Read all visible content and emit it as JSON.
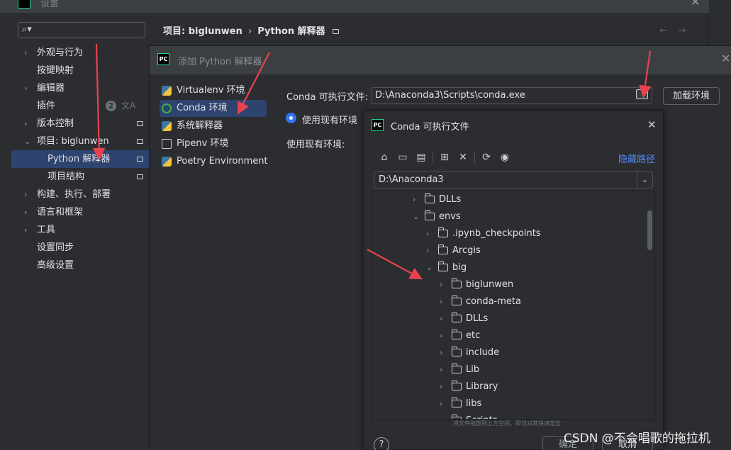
{
  "settings": {
    "title": "设置",
    "search_placeholder": "",
    "sidebar": [
      {
        "label": "外观与行为",
        "expandable": true,
        "expanded": false
      },
      {
        "label": "按键映射",
        "expandable": false
      },
      {
        "label": "编辑器",
        "expandable": true,
        "expanded": false
      },
      {
        "label": "插件",
        "expandable": false,
        "badge": "2"
      },
      {
        "label": "版本控制",
        "expandable": true,
        "expanded": false
      },
      {
        "label": "项目: biglunwen",
        "expandable": true,
        "expanded": true
      },
      {
        "label": "Python 解释器",
        "child": true,
        "selected": true
      },
      {
        "label": "项目结构",
        "child": true
      },
      {
        "label": "构建、执行、部署",
        "expandable": true,
        "expanded": false
      },
      {
        "label": "语言和框架",
        "expandable": true,
        "expanded": false
      },
      {
        "label": "工具",
        "expandable": true,
        "expanded": false
      },
      {
        "label": "设置同步",
        "expandable": false
      },
      {
        "label": "高级设置",
        "expandable": false
      }
    ],
    "breadcrumb": {
      "project": "项目: biglunwen",
      "separator": "›",
      "page": "Python 解释器"
    }
  },
  "add_interpreter": {
    "title": "添加 Python 解释器",
    "env_types": [
      {
        "label": "Virtualenv 环境",
        "icon": "python-icon"
      },
      {
        "label": "Conda 环境",
        "icon": "conda-icon",
        "selected": true
      },
      {
        "label": "系统解释器",
        "icon": "python-icon"
      },
      {
        "label": "Pipenv 环境",
        "icon": "pipenv-icon"
      },
      {
        "label": "Poetry Environment",
        "icon": "python-icon"
      }
    ],
    "conda_exe_label": "Conda 可执行文件:",
    "conda_exe_value": "D:\\Anaconda3\\Scripts\\conda.exe",
    "load_env_button": "加载环境",
    "use_existing_label": "使用现有环境",
    "existing_env_label": "使用现有环境:"
  },
  "file_chooser": {
    "title": "Conda 可执行文件",
    "hide_path": "隐藏路径",
    "path_value": "D:\\Anaconda3",
    "tree": [
      {
        "name": "DLLs",
        "depth": 0,
        "expanded": false
      },
      {
        "name": "envs",
        "depth": 0,
        "expanded": true
      },
      {
        "name": ".ipynb_checkpoints",
        "depth": 1,
        "expanded": false
      },
      {
        "name": "Arcgis",
        "depth": 1,
        "expanded": false
      },
      {
        "name": "big",
        "depth": 1,
        "expanded": true
      },
      {
        "name": "biglunwen",
        "depth": 2,
        "expanded": false
      },
      {
        "name": "conda-meta",
        "depth": 2,
        "expanded": false
      },
      {
        "name": "DLLs",
        "depth": 2,
        "expanded": false
      },
      {
        "name": "etc",
        "depth": 2,
        "expanded": false
      },
      {
        "name": "include",
        "depth": 2,
        "expanded": false
      },
      {
        "name": "Lib",
        "depth": 2,
        "expanded": false
      },
      {
        "name": "Library",
        "depth": 2,
        "expanded": false
      },
      {
        "name": "libs",
        "depth": 2,
        "expanded": false
      },
      {
        "name": "Scripts",
        "depth": 2,
        "expanded": false
      }
    ],
    "drag_hint": "将文件拖放到上方空间，即可对其快速定位",
    "help": "?",
    "ok_button": "确定",
    "cancel_button": "取消"
  },
  "watermark": "CSDN @不会唱歌的拖拉机",
  "colors": {
    "accent": "#3574f0",
    "selected_bg": "#2e436e",
    "link": "#548af7",
    "annotation": "#e8424f"
  }
}
